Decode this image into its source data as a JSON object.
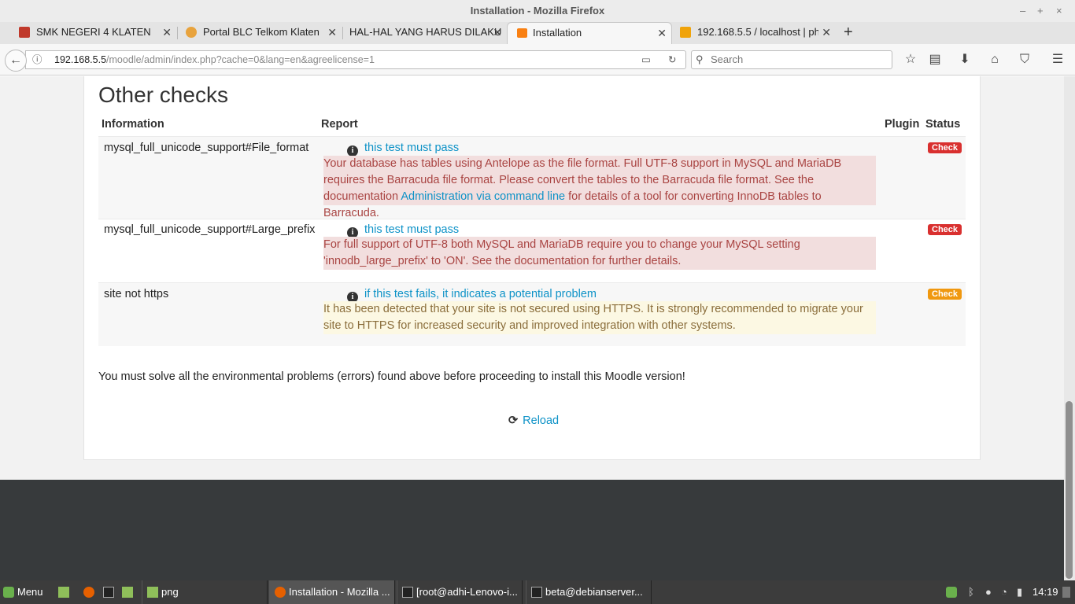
{
  "window": {
    "title": "Installation - Mozilla Firefox",
    "controls": [
      "–",
      "+",
      "×"
    ]
  },
  "tabs": [
    {
      "label": "SMK NEGERI 4 KLATEN",
      "icon": "school-logo-icon",
      "color": "#c0392b"
    },
    {
      "label": "Portal BLC Telkom Klaten",
      "icon": "blc-logo-icon",
      "color": "#e8a33d"
    },
    {
      "label": "HAL-HAL YANG HARUS DILAKU",
      "icon": "blank-page-icon",
      "color": "#e4e4e4"
    },
    {
      "label": "Installation",
      "icon": "moodle-icon",
      "color": "#f98012"
    },
    {
      "label": "192.168.5.5 / localhost | ph",
      "icon": "phpmyadmin-icon",
      "color": "#f0a30a"
    }
  ],
  "nav": {
    "url_host": "192.168.5.5",
    "url_path": "/moodle/admin/index.php?cache=0&lang=en&agreelicense=1",
    "search_placeholder": "Search"
  },
  "page": {
    "heading": "Other checks",
    "columns": [
      "Information",
      "Report",
      "Plugin",
      "Status"
    ],
    "rows": [
      {
        "info": "mysql_full_unicode_support#File_format",
        "report": "this test must pass",
        "msg_pre": "Your database has tables using Antelope as the file format. Full UTF-8 support in MySQL and MariaDB requires the Barracuda file format. Please convert the tables to the Barracuda file format. See the documentation ",
        "msg_link": "Administration via command line",
        "msg_post": " for details of a tool for converting InnoDB tables to Barracuda.",
        "status": "Check"
      },
      {
        "info": "mysql_full_unicode_support#Large_prefix",
        "report": "this test must pass",
        "msg": "For full support of UTF-8 both MySQL and MariaDB require you to change your MySQL setting 'innodb_large_prefix' to 'ON'. See the documentation for further details.",
        "status": "Check"
      },
      {
        "info": "site not https",
        "report": "if this test fails, it indicates a potential problem",
        "msg": "It has been detected that your site is not secured using HTTPS. It is strongly recommended to migrate your site to HTTPS for increased security and improved integration with other systems.",
        "status": "Check"
      }
    ],
    "notice": "You must solve all the environmental problems (errors) found above before proceeding to install this Moodle version!",
    "reload": "Reload"
  },
  "taskbar": {
    "menu": "Menu",
    "folder": "png",
    "windows": [
      "Installation - Mozilla ...",
      "[root@adhi-Lenovo-i...",
      "beta@debianserver..."
    ],
    "clock": "14:19"
  }
}
